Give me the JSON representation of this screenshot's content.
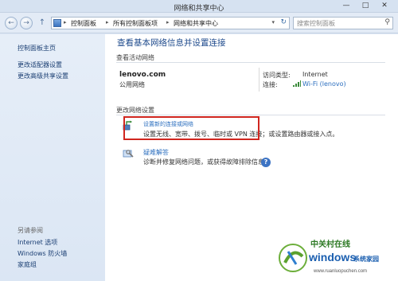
{
  "window": {
    "title": "网络和共享中心",
    "controls": {
      "minimize": "—",
      "maximize": "□",
      "close": "✕"
    }
  },
  "nav": {
    "back_glyph": "←",
    "forward_glyph": "→",
    "up_glyph": "↑",
    "breadcrumbs": [
      "控制面板",
      "所有控制面板项",
      "网络和共享中心"
    ],
    "crumb_separator": "▸",
    "dropdown_glyph": "▾",
    "refresh_glyph": "↻",
    "search_placeholder": "搜索控制面板",
    "search_glyph": "⚲"
  },
  "sidebar": {
    "items": [
      "控制面板主页",
      "更改适配器设置",
      "更改高级共享设置"
    ],
    "see_also_heading": "另请参阅",
    "see_also_items": [
      "Internet 选项",
      "Windows 防火墙",
      "家庭组"
    ]
  },
  "main": {
    "title": "查看基本网络信息并设置连接",
    "active_networks_label": "查看活动网络",
    "network": {
      "name": "lenovo.com",
      "type": "公用网络",
      "access_type_label": "访问类型:",
      "access_type_value": "Internet",
      "connection_label": "连接:",
      "connection_value": "Wi-Fi (lenovo)"
    },
    "change_settings_label": "更改网络设置",
    "tasks": [
      {
        "link": "设置新的连接或网络",
        "desc": "设置无线、宽带、拨号、临时或 VPN 连接；或设置路由器或接入点。"
      },
      {
        "link": "疑难解答",
        "desc": "诊断并修复网络问题，或获得故障排除信息。"
      }
    ],
    "help_glyph": "?"
  },
  "watermark": {
    "text_line1": "中关村在线",
    "text_line2": "windows系统家园",
    "text_line3": "www.ruanluopuchen.com"
  },
  "colors": {
    "accent_link": "#2c6fbf",
    "title_blue": "#1e4a8c",
    "highlight_red": "#d0261f"
  }
}
